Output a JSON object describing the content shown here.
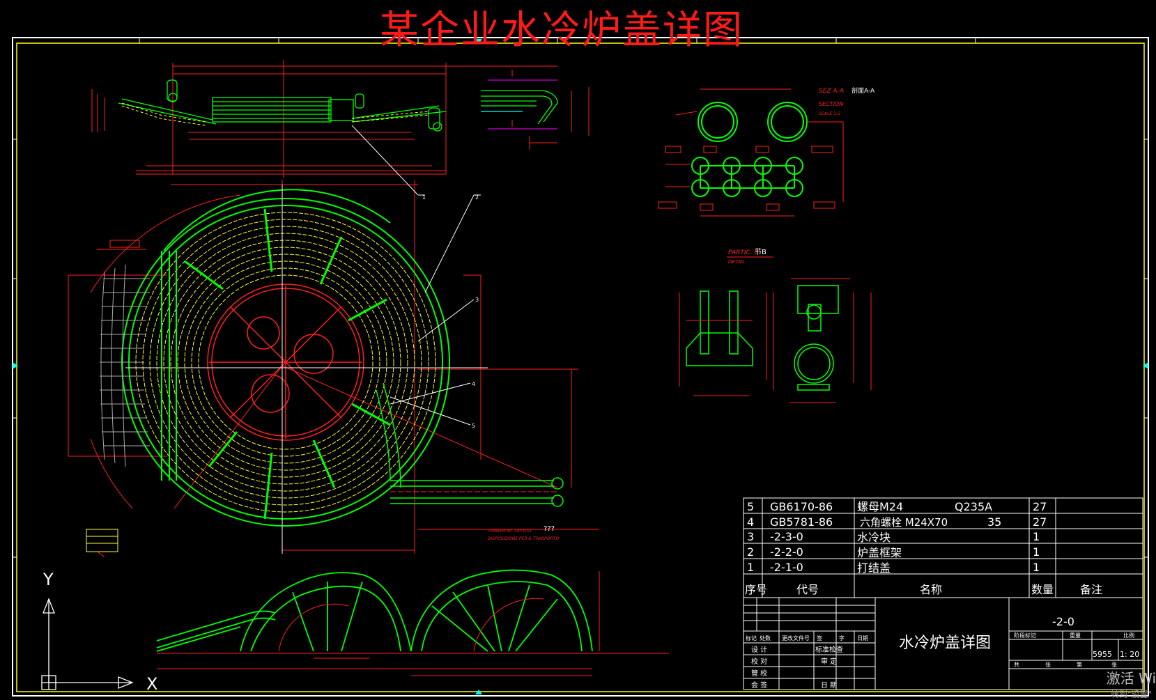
{
  "title": "某企业水冷炉盖详图",
  "colors": {
    "background": "#000000",
    "frame": "#ffffff",
    "coil": "#ffff33",
    "frame_green": "#00ff00",
    "dimension": "#ff2020",
    "title": "#ff1a1a"
  },
  "parts": [
    {
      "no": "5",
      "code": "GB6170-86",
      "name": "螺母M24",
      "material": "Q235A",
      "qty": "27"
    },
    {
      "no": "4",
      "code": "GB5781-86",
      "name": "六角螺栓   M24X70",
      "material": "35",
      "qty": "27"
    },
    {
      "no": "3",
      "code": "-2-3-0",
      "name": "水冷块",
      "material": "",
      "qty": "1"
    },
    {
      "no": "2",
      "code": "-2-2-0",
      "name": "炉盖框架",
      "material": "",
      "qty": "1"
    },
    {
      "no": "1",
      "code": "-2-1-0",
      "name": "打结盖",
      "material": "",
      "qty": "1"
    }
  ],
  "parts_header": {
    "no": "序号",
    "code": "代号",
    "name": "名称",
    "qty": "数量",
    "remark": "备注"
  },
  "title_block": {
    "drawing_name": "水冷炉盖详图",
    "drawing_no": "-2-0",
    "weight": "5955",
    "scale": "1: 20",
    "labels_row": [
      "标记",
      "处数",
      "更改文件号",
      "签",
      "字",
      "日期"
    ],
    "label_design": "设  计",
    "label_std": "标准检查",
    "label_check": "校  对",
    "label_review": "审  定",
    "label_manage": "管  校",
    "label_sign": "会  签",
    "label_date": "日  期",
    "right_header": [
      "阶段标记",
      "重量",
      "比例"
    ],
    "sheet": [
      "共",
      "张",
      "第",
      "张"
    ]
  },
  "section_labels": {
    "sez": "SEZ A-A",
    "sez_cn": "剖面A-A",
    "section": "SECTION",
    "scale_section": "SCALE 1:5",
    "partic": "PARTIC. B",
    "partic_cn": "节B",
    "detail": "DETAIL",
    "transport": "TRANSPORT LAY-OUT",
    "transport_q": "???",
    "disposizione": "DISPOSIZIONE PER IL TRASPORTO"
  },
  "axis": {
    "y": "Y",
    "x": "X"
  },
  "watermark": {
    "line1": "激活 Wi",
    "line2": "转到\"设置\""
  }
}
